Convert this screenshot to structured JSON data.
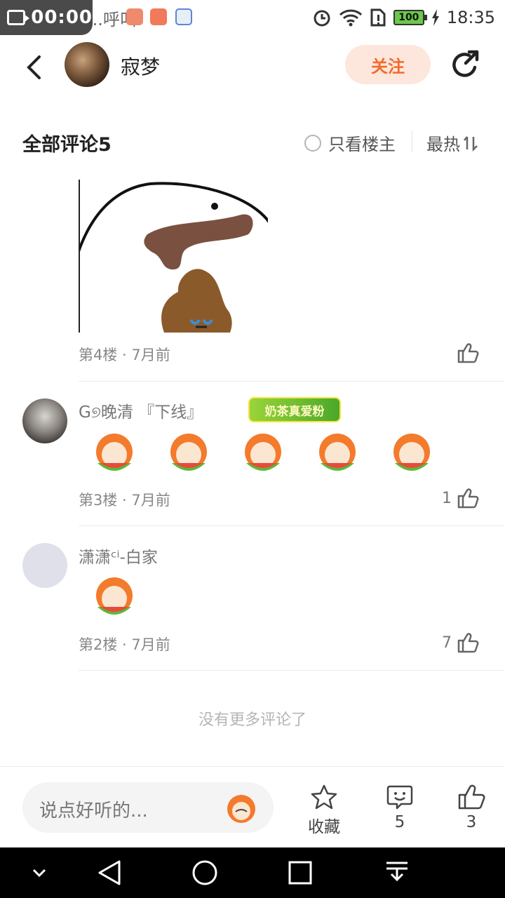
{
  "status_bar": {
    "record_time": "00:00",
    "background_text": "飞...呼叫",
    "time": "18:35",
    "battery": "100"
  },
  "header": {
    "user_name": "寂梦",
    "follow_label": "关注"
  },
  "comments_bar": {
    "title": "全部评论5",
    "owner_only_label": "只看楼主",
    "sort_label": "最热"
  },
  "comments": [
    {
      "floor": "第4楼 · 7月前",
      "likes": ""
    },
    {
      "name": "G୭晚清  『下线』",
      "badge": "奶茶真爱粉",
      "floor": "第3楼 · 7月前",
      "likes": "1"
    },
    {
      "name": "潇潇ᶜⁱ-白家",
      "floor": "第2楼 · 7月前",
      "likes": "7"
    }
  ],
  "no_more_text": "没有更多评论了",
  "bottom_bar": {
    "input_placeholder": "说点好听的...",
    "favorite_label": "收藏",
    "comment_count": "5",
    "like_count": "3"
  },
  "colors": {
    "accent": "#f36b2c",
    "follow_bg": "#fde6dc"
  }
}
